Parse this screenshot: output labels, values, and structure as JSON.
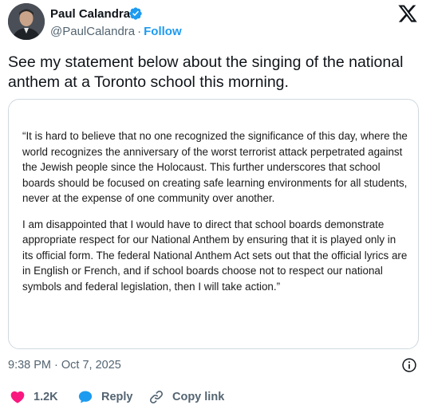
{
  "author": {
    "name": "Paul Calandra",
    "handle": "@PaulCalandra",
    "separator": "·",
    "follow_label": "Follow"
  },
  "tweet": {
    "text": "See my statement below about the singing of the national anthem at a Toronto school this morning.",
    "timestamp": "9:38 PM · Oct 7, 2025"
  },
  "statement": {
    "paragraphs": [
      "“It is hard to believe that no one recognized the significance of this day, where the world recognizes the anniversary of the worst terrorist attack perpetrated against the Jewish people since the Holocaust. This further underscores that school boards should be focused on creating safe learning environments for all students, never at the expense of one community over another.",
      "I am disappointed that I would have to direct that school boards demonstrate appropriate respect for our National Anthem by ensuring that it is played only in its official form. The federal National Anthem Act sets out that the official lyrics are in English or French, and if school boards choose not to respect our national symbols and federal legislation, then I will take action.”"
    ]
  },
  "actions": {
    "like_count": "1.2K",
    "reply_label": "Reply",
    "copy_label": "Copy link"
  },
  "icons": {
    "verified": "verified-badge-icon",
    "logo": "x-logo-icon",
    "info": "info-icon",
    "like": "heart-icon",
    "reply": "reply-bubble-icon",
    "copy": "link-icon"
  },
  "colors": {
    "accent": "#1d9bf0",
    "like": "#f91880",
    "secondary_text": "#536471",
    "primary_text": "#0f1419",
    "card_border": "#cfd9de"
  }
}
